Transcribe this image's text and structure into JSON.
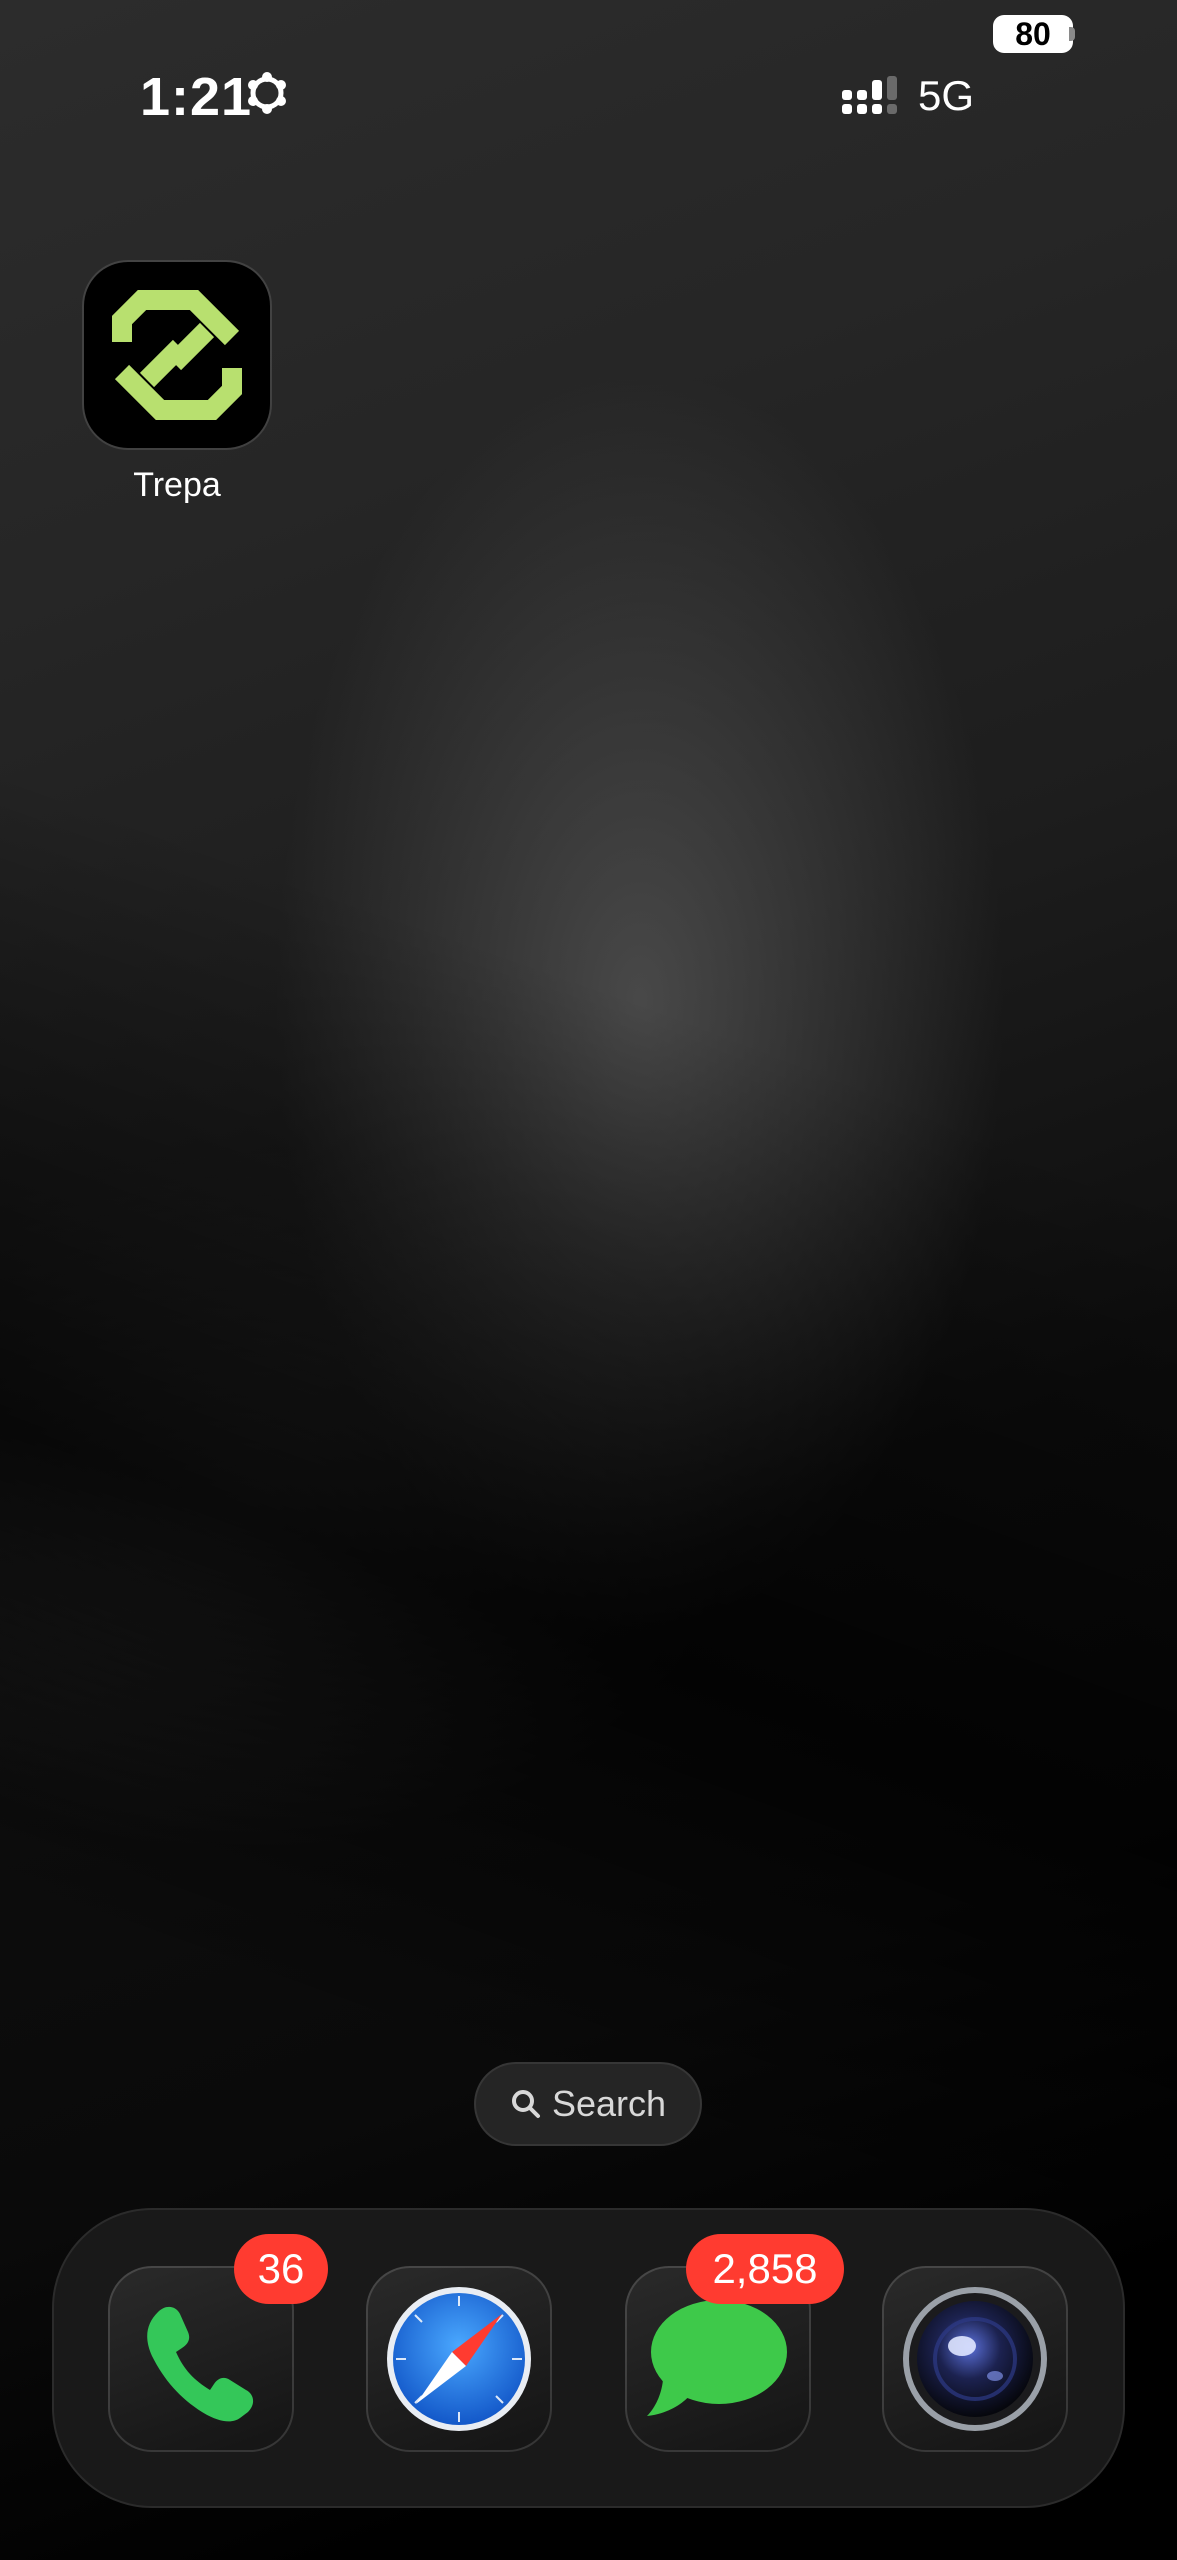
{
  "status_bar": {
    "time": "1:21",
    "focus_icon": "focus-mode-icon",
    "network": "5G",
    "battery_level": "80",
    "signal_icon": "cellular-signal-icon"
  },
  "home_screen": {
    "apps": [
      {
        "label": "Trepa",
        "icon": "trepa-logo-icon",
        "accent": "#b8e06f"
      }
    ]
  },
  "search": {
    "label": "Search",
    "icon": "magnifier-icon"
  },
  "dock": {
    "apps": [
      {
        "name": "phone",
        "icon": "phone-icon",
        "badge": "36"
      },
      {
        "name": "safari",
        "icon": "compass-icon",
        "badge": ""
      },
      {
        "name": "messages",
        "icon": "message-bubble-icon",
        "badge": "2,858"
      },
      {
        "name": "camera",
        "icon": "camera-lens-icon",
        "badge": ""
      }
    ]
  },
  "colors": {
    "badge": "#ff3b30",
    "phone_green": "#34c759",
    "messages_green": "#3ec94a",
    "safari_blue": "#1e6fe0"
  }
}
